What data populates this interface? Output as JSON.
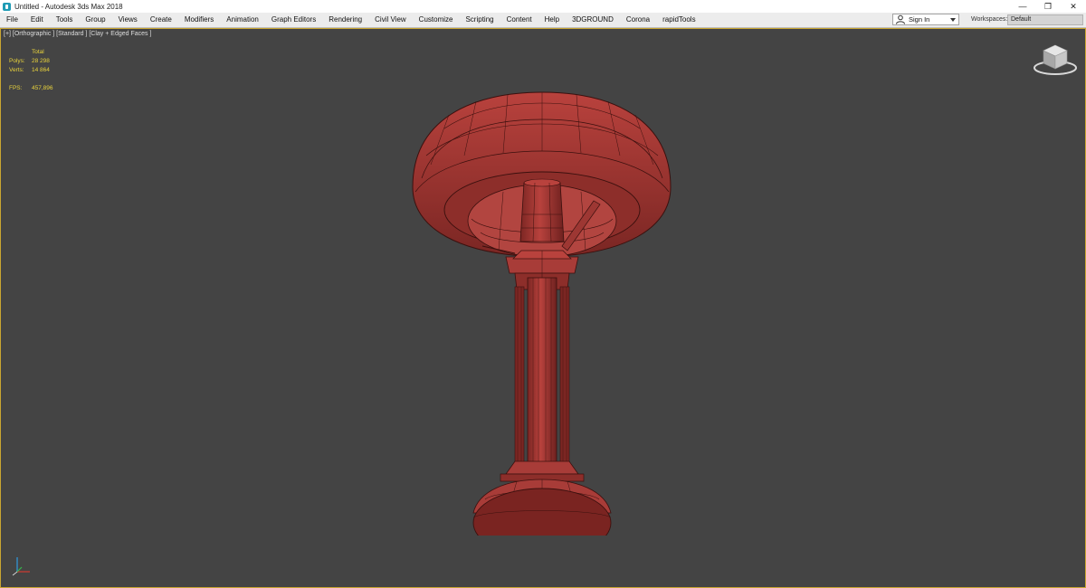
{
  "window": {
    "title": "Untitled - Autodesk 3ds Max 2018",
    "minimize_glyph": "—",
    "restore_glyph": "❐",
    "close_glyph": "✕"
  },
  "menu": {
    "items": [
      "File",
      "Edit",
      "Tools",
      "Group",
      "Views",
      "Create",
      "Modifiers",
      "Animation",
      "Graph Editors",
      "Rendering",
      "Civil View",
      "Customize",
      "Scripting",
      "Content",
      "Help",
      "3DGROUND",
      "Corona",
      "rapidTools"
    ],
    "sign_in": "Sign In",
    "workspaces_label": "Workspaces:",
    "workspace_value": "Default"
  },
  "viewport": {
    "label": "[+] [Orthographic ] [Standard ] [Clay + Edged Faces ]",
    "stats": {
      "header": "Total",
      "polys_label": "Polys:",
      "polys_value": "28 298",
      "verts_label": "Verts:",
      "verts_value": "14 864",
      "fps_label": "FPS:",
      "fps_value": "457,896"
    },
    "model_color": "#a33a36",
    "wire_color": "#3b100e"
  },
  "icons": {
    "app": "3dsmax-app-icon",
    "user": "user-icon",
    "viewcube": "viewcube-icon",
    "axis": "axis-tripod-icon"
  }
}
